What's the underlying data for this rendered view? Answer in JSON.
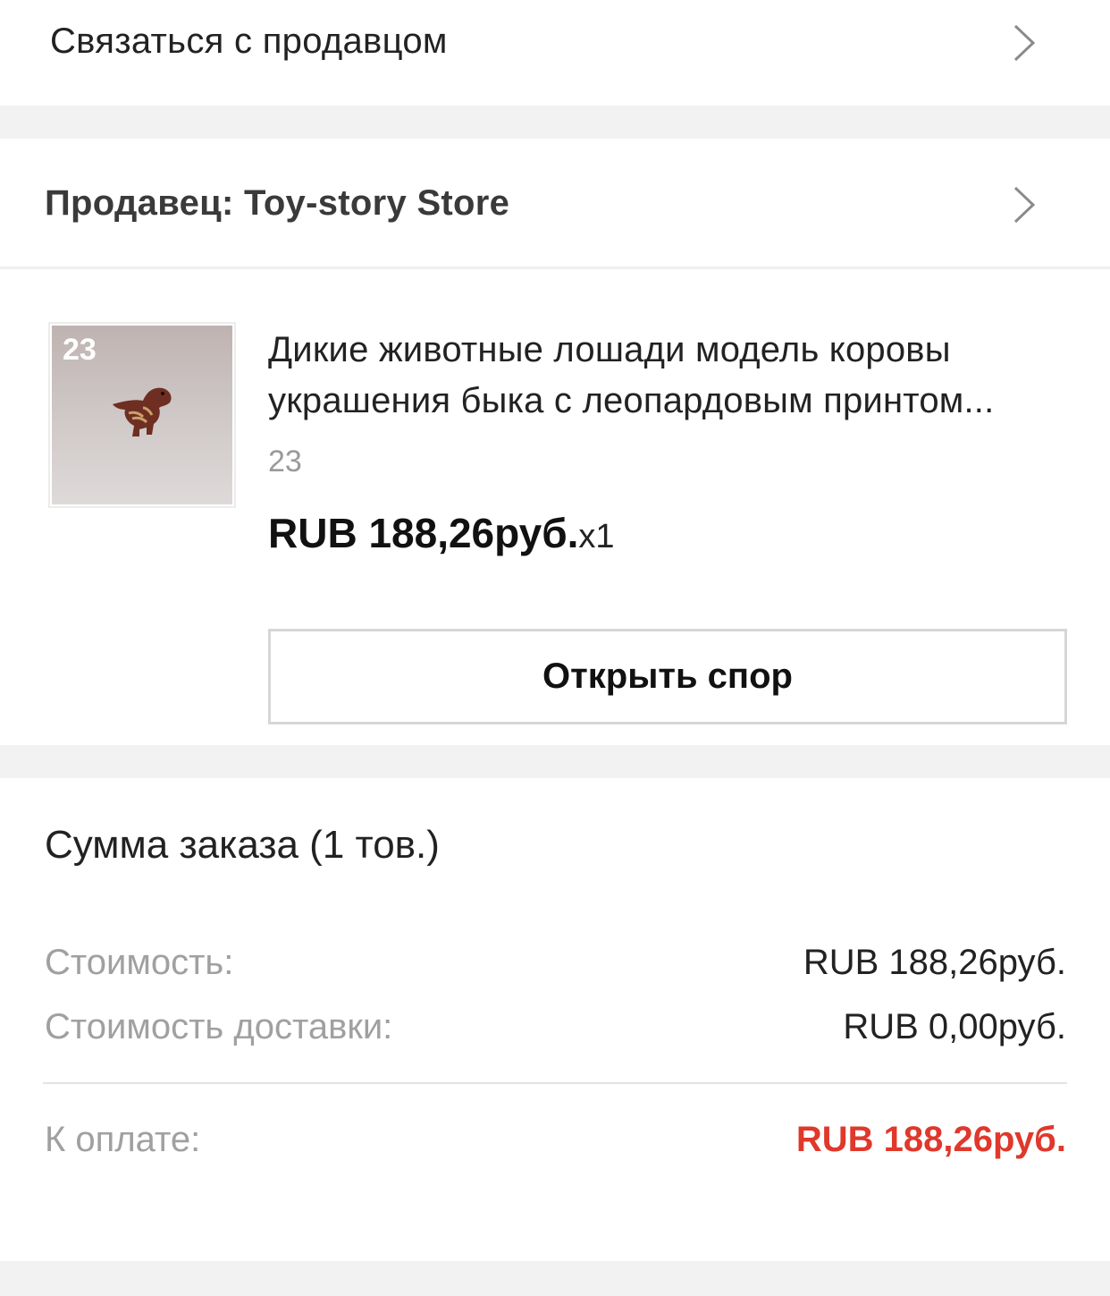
{
  "contact": {
    "label": "Связаться с продавцом"
  },
  "seller": {
    "label": "Продавец: Toy-story Store"
  },
  "product": {
    "thumb_number": "23",
    "title_line1": "Дикие животные лошади модель коровы",
    "title_line2": "украшения быка с леопардовым принтом...",
    "variant": "23",
    "price": "RUB 188,26руб.",
    "quantity": "x1"
  },
  "dispute_button": {
    "label": "Открыть спор"
  },
  "summary": {
    "title": "Сумма заказа (1 тов.)",
    "cost_label": "Стоимость:",
    "cost_value": "RUB 188,26руб.",
    "shipping_label": "Стоимость доставки:",
    "shipping_value": "RUB 0,00руб.",
    "total_label": "К оплате:",
    "total_value": "RUB 188,26руб."
  },
  "colors": {
    "background": "#f2f2f2",
    "card": "#ffffff",
    "total_accent": "#e0382b",
    "secondary_text": "#a0a0a0"
  },
  "icons": {
    "row_arrow": "chevron-right-icon",
    "product_image": "dinosaur-figurine"
  }
}
